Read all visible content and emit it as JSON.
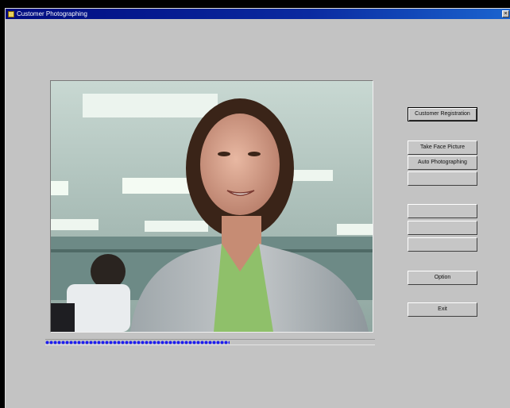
{
  "window": {
    "title": "Customer Photographing",
    "close_glyph": "×"
  },
  "capture": {
    "progress": 0.56
  },
  "buttons": {
    "customer_registration": "Customer Registration",
    "take_face_picture": "Take Face Picture",
    "auto_photographing": "Auto Photographing",
    "blank_1": "",
    "blank_2": "",
    "blank_3": "",
    "blank_4": "",
    "option": "Option",
    "exit": "Exit"
  },
  "colors": {
    "titlebar_start": "#000b80",
    "titlebar_end": "#1a64cf",
    "progress_dots": "#1d1df0",
    "window_bg": "#c3c3c3"
  }
}
